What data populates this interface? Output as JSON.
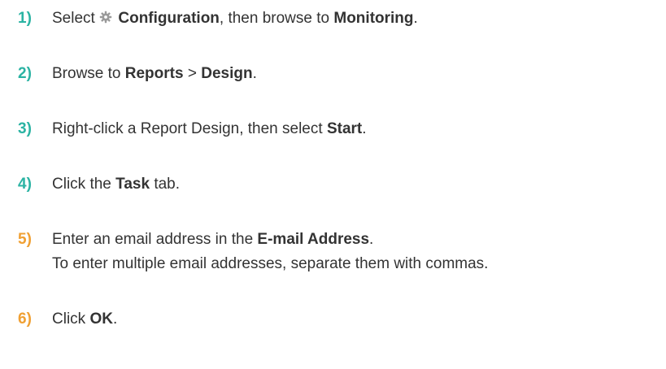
{
  "steps": [
    {
      "number": "1)",
      "parts": [
        "Select ",
        "Configuration",
        ", then browse to ",
        "Monitoring",
        "."
      ],
      "icon": "gear-icon"
    },
    {
      "number": "2)",
      "parts": [
        "Browse to ",
        "Reports",
        " > ",
        "Design",
        "."
      ]
    },
    {
      "number": "3)",
      "parts": [
        "Right-click a Report Design, then select ",
        "Start",
        "."
      ]
    },
    {
      "number": "4)",
      "parts": [
        "Click the ",
        "Task",
        " tab."
      ]
    },
    {
      "number": "5)",
      "parts": [
        "Enter an email address in the ",
        "E-mail Address",
        "."
      ],
      "note": "To enter multiple email addresses, separate them with commas."
    },
    {
      "number": "6)",
      "parts": [
        "Click ",
        "OK",
        "."
      ]
    }
  ],
  "colors": {
    "number_teal": "#2bb3a3",
    "number_orange": "#f0a033",
    "text": "#333333",
    "icon": "#9a9a9a"
  }
}
